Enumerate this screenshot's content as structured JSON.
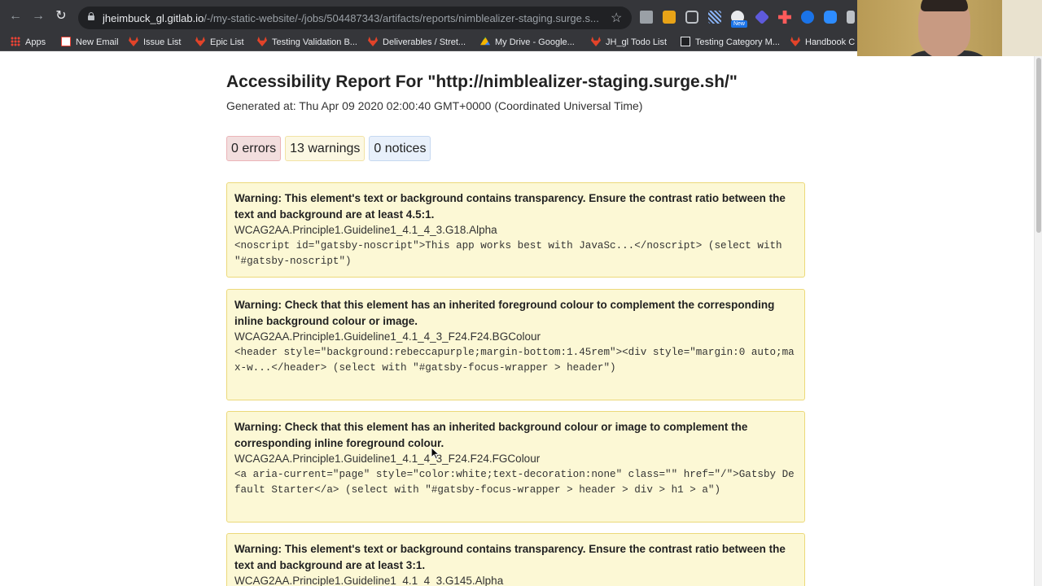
{
  "browser": {
    "url_host": "jheimbuck_gl.gitlab.io",
    "url_path": "/-/my-static-website/-/jobs/504487343/artifacts/reports/nimblealizer-staging.surge.s...",
    "new_badge": "New",
    "bookmarks": [
      {
        "label": "Apps",
        "icon": "apps-icon"
      },
      {
        "label": "New Email",
        "icon": "gmail-icon"
      },
      {
        "label": "Issue List",
        "icon": "gitlab-icon"
      },
      {
        "label": "Epic List",
        "icon": "gitlab-icon"
      },
      {
        "label": "Testing Validation B...",
        "icon": "gitlab-icon"
      },
      {
        "label": "Deliverables / Stret...",
        "icon": "gitlab-icon"
      },
      {
        "label": "My Drive - Google...",
        "icon": "google-drive-icon"
      },
      {
        "label": "JH_gl Todo List",
        "icon": "gitlab-icon"
      },
      {
        "label": "Testing Category M...",
        "icon": "flag-icon"
      },
      {
        "label": "Handbook C",
        "icon": "gitlab-icon"
      }
    ]
  },
  "report": {
    "title": "Accessibility Report For \"http://nimblealizer-staging.surge.sh/\"",
    "generated": "Generated at: Thu Apr 09 2020 02:00:40 GMT+0000 (Coordinated Universal Time)",
    "counts": {
      "errors": "0 errors",
      "warnings": "13 warnings",
      "notices": "0 notices"
    },
    "issues": [
      {
        "message": "Warning: This element's text or background contains transparency. Ensure the contrast ratio between the text and background are at least 4.5:1.",
        "code": "WCAG2AA.Principle1.Guideline1_4.1_4_3.G18.Alpha",
        "context": "<noscript id=\"gatsby-noscript\">This app works best with JavaSc...</noscript> (select with \"#gatsby-noscript\")"
      },
      {
        "message": "Warning: Check that this element has an inherited foreground colour to complement the corresponding inline background colour or image.",
        "code": "WCAG2AA.Principle1.Guideline1_4.1_4_3_F24.F24.BGColour",
        "context": "<header style=\"background:rebeccapurple;margin-bottom:1.45rem\"><div style=\"margin:0 auto;max-w...</header> (select with \"#gatsby-focus-wrapper > header\")"
      },
      {
        "message": "Warning: Check that this element has an inherited background colour or image to complement the corresponding inline foreground colour.",
        "code": "WCAG2AA.Principle1.Guideline1_4.1_4_3_F24.F24.FGColour",
        "context": "<a aria-current=\"page\" style=\"color:white;text-decoration:none\" class=\"\" href=\"/\">Gatsby Default Starter</a> (select with \"#gatsby-focus-wrapper > header > div > h1 > a\")"
      },
      {
        "message": "Warning: This element's text or background contains transparency. Ensure the contrast ratio between the text and background are at least 3:1.",
        "code": "WCAG2AA.Principle1.Guideline1_4.1_4_3.G145.Alpha"
      }
    ]
  }
}
